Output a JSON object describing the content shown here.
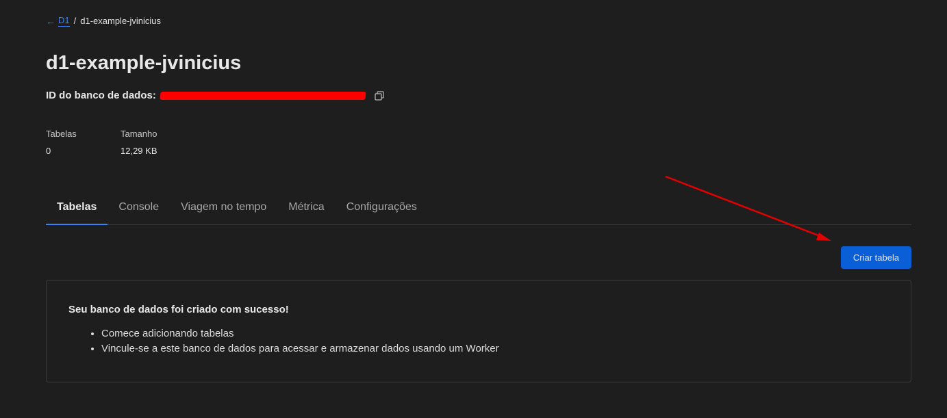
{
  "breadcrumb": {
    "back_label": "D1",
    "separator": "/",
    "current": "d1-example-jvinicius"
  },
  "page_title": "d1-example-jvinicius",
  "database_id": {
    "label": "ID do banco de dados:"
  },
  "stats": {
    "tables_label": "Tabelas",
    "tables_value": "0",
    "size_label": "Tamanho",
    "size_value": "12,29 KB"
  },
  "tabs": [
    {
      "label": "Tabelas",
      "active": true
    },
    {
      "label": "Console",
      "active": false
    },
    {
      "label": "Viagem no tempo",
      "active": false
    },
    {
      "label": "Métrica",
      "active": false
    },
    {
      "label": "Configurações",
      "active": false
    }
  ],
  "create_button_label": "Criar tabela",
  "success_panel": {
    "title": "Seu banco de dados foi criado com sucesso!",
    "items": [
      "Comece adicionando tabelas",
      "Vincule-se a este banco de dados para acessar e armazenar dados usando um Worker"
    ]
  },
  "colors": {
    "background": "#1e1e1e",
    "accent": "#3b82f6",
    "button": "#0b5fd6",
    "annotation_arrow": "#e00000",
    "redaction": "#ff0000"
  },
  "icons": [
    "arrow-left-icon",
    "copy-icon"
  ]
}
